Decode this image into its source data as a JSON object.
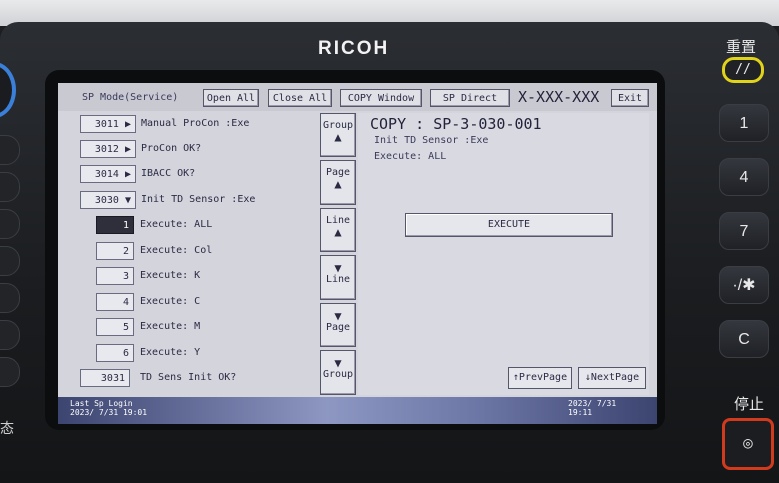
{
  "device": {
    "brand": "RICOH"
  },
  "header": {
    "mode": "SP Mode(Service)",
    "open_all": "Open All",
    "close_all": "Close All",
    "copy_window": "COPY Window",
    "sp_direct": "SP Direct",
    "sp_code": "X-XXX-XXX",
    "exit": "Exit"
  },
  "list": [
    {
      "code": "3011",
      "arrow": "▶",
      "label": "Manual ProCon :Exe"
    },
    {
      "code": "3012",
      "arrow": "▶",
      "label": "ProCon OK?"
    },
    {
      "code": "3014",
      "arrow": "▶",
      "label": "IBACC OK?"
    },
    {
      "code": "3030",
      "arrow": "▼",
      "label": "Init TD Sensor :Exe"
    },
    {
      "code": "1",
      "label": "Execute: ALL"
    },
    {
      "code": "2",
      "label": "Execute: Col"
    },
    {
      "code": "3",
      "label": "Execute: K"
    },
    {
      "code": "4",
      "label": "Execute: C"
    },
    {
      "code": "5",
      "label": "Execute: M"
    },
    {
      "code": "6",
      "label": "Execute: Y"
    },
    {
      "code": "3031",
      "label": "TD Sens Init OK?"
    }
  ],
  "scroll": {
    "group_up": "Group",
    "page_up": "Page",
    "line_up": "Line",
    "line_down": "Line",
    "page_down": "Page",
    "group_down": "Group",
    "up_arrow": "▲",
    "down_arrow": "▼"
  },
  "panel": {
    "title": "COPY : SP-3-030-001",
    "line1": "Init TD Sensor :Exe",
    "line2": "Execute: ALL",
    "execute": "EXECUTE",
    "prev_page": "↑PrevPage",
    "next_page": "↓NextPage"
  },
  "footer": {
    "login_label": "Last Sp Login",
    "login_time": "2023/ 7/31 19:01",
    "date": "2023/ 7/31",
    "time": "19:11"
  },
  "keypad": {
    "reset_label": "重置",
    "reset_icon": "//",
    "keys": [
      "1",
      "4",
      "7",
      "·/✱",
      "C"
    ],
    "stop_label": "停止",
    "stop_icon": "◎"
  },
  "side": {
    "char": "态"
  },
  "colors": {
    "accent_yellow": "#e1d31a",
    "stop_red": "#d23a1e",
    "lcd_bg": "#d4d5dc",
    "footer_blue": "#6d77a6"
  }
}
